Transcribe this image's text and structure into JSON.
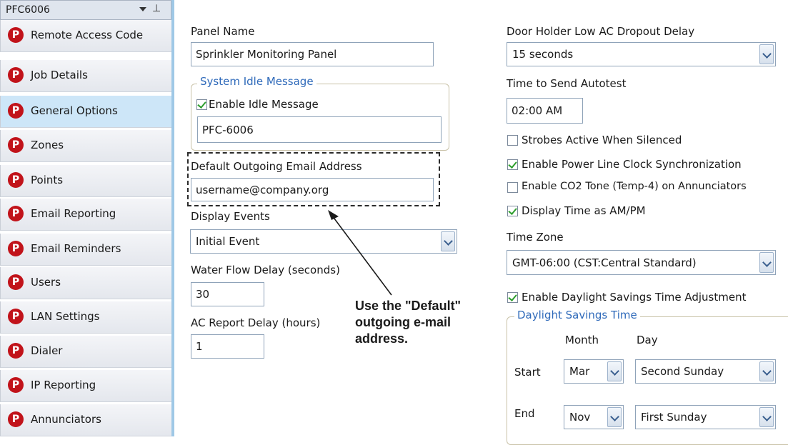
{
  "sidebar": {
    "title": "PFC6006",
    "items": [
      {
        "label": "Remote Access Code",
        "icon": "P"
      },
      {
        "label": "Job Details",
        "icon": "P"
      },
      {
        "label": "General Options",
        "icon": "P",
        "active": true
      },
      {
        "label": "Zones",
        "icon": "P"
      },
      {
        "label": "Points",
        "icon": "P"
      },
      {
        "label": "Email Reporting",
        "icon": "P"
      },
      {
        "label": "Email Reminders",
        "icon": "P"
      },
      {
        "label": "Users",
        "icon": "P"
      },
      {
        "label": "LAN Settings",
        "icon": "P"
      },
      {
        "label": "Dialer",
        "icon": "P"
      },
      {
        "label": "IP Reporting",
        "icon": "P"
      },
      {
        "label": "Annunciators",
        "icon": "P"
      }
    ]
  },
  "left": {
    "panel_name_label": "Panel Name",
    "panel_name_value": "Sprinkler Monitoring Panel",
    "idle_group_title": "System Idle Message",
    "enable_idle_label": "Enable Idle Message",
    "enable_idle_checked": true,
    "idle_message_value": "PFC-6006",
    "email_label": "Default Outgoing Email Address",
    "email_value": "username@company.org",
    "display_events_label": "Display Events",
    "display_events_value": "Initial Event",
    "water_flow_label": "Water Flow Delay (seconds)",
    "water_flow_value": "30",
    "ac_report_label": "AC Report Delay (hours)",
    "ac_report_value": "1"
  },
  "right": {
    "door_holder_label": "Door Holder Low AC Dropout Delay",
    "door_holder_value": "15 seconds",
    "autotest_label": "Time to Send Autotest",
    "autotest_value": "02:00 AM",
    "checks": [
      {
        "label": "Strobes Active When Silenced",
        "checked": false
      },
      {
        "label": "Enable Power Line Clock Synchronization",
        "checked": true
      },
      {
        "label": "Enable CO2 Tone (Temp-4) on Annunciators",
        "checked": false
      },
      {
        "label": "Display Time as AM/PM",
        "checked": true
      }
    ],
    "time_zone_label": "Time Zone",
    "time_zone_value": "GMT-06:00 (CST:Central Standard)",
    "dst_enable_label": "Enable Daylight Savings Time Adjustment",
    "dst_enable_checked": true,
    "dst_group_title": "Daylight Savings Time",
    "month_header": "Month",
    "day_header": "Day",
    "start_label": "Start",
    "start_month": "Mar",
    "start_day": "Second Sunday",
    "end_label": "End",
    "end_month": "Nov",
    "end_day": "First Sunday"
  },
  "callout": {
    "line1": "Use the \"Default\"",
    "line2": "outgoing e-mail",
    "line3": "address."
  }
}
